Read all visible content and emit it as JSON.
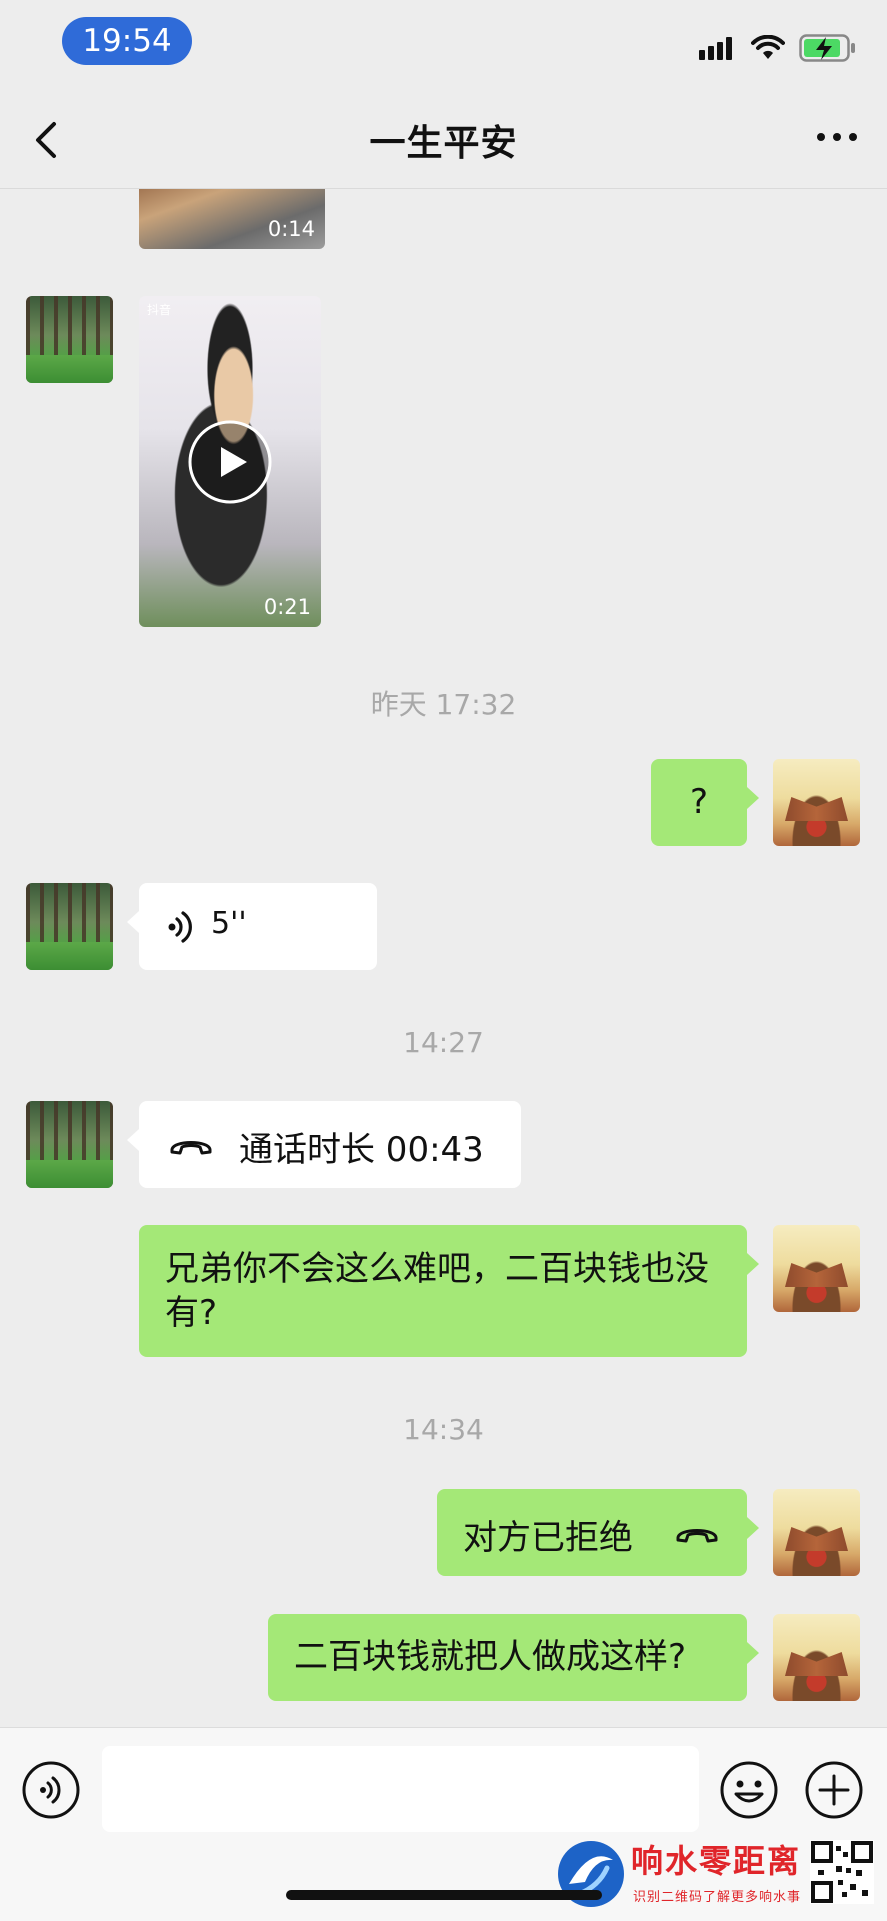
{
  "status_bar": {
    "time": "19:54"
  },
  "nav": {
    "title": "一生平安"
  },
  "messages": {
    "video1_duration": "0:14",
    "video2_duration": "0:21",
    "video2_brand": "抖音",
    "timestamp1": "昨天 17:32",
    "out_question": "?",
    "voice_duration": "5''",
    "timestamp2": "14:27",
    "call_text": "通话时长 00:43",
    "out_text1": "兄弟你不会这么难吧，二百块钱也没有?",
    "timestamp3": "14:34",
    "rejected_text": "对方已拒绝",
    "out_text2": "二百块钱就把人做成这样?"
  },
  "watermark": {
    "title": "响水零距离",
    "subtitle": "识别二维码了解更多响水事"
  },
  "icons": [
    "back-arrow-icon",
    "more-dots-icon",
    "signal-icon",
    "wifi-icon",
    "battery-charging-icon",
    "play-icon",
    "voice-wave-icon",
    "phone-handset-icon",
    "emoji-icon",
    "plus-icon"
  ],
  "colors": {
    "bubble_out": "#a4e877",
    "bubble_in": "#ffffff",
    "background": "#ededed",
    "time_pill": "#2f6bd8"
  }
}
